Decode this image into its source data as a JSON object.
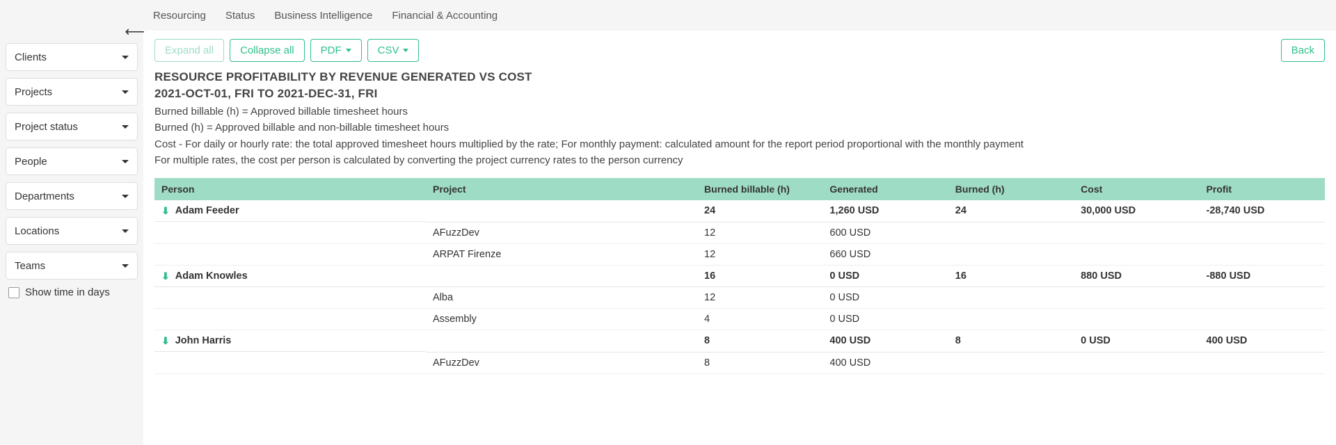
{
  "topnav": {
    "items": [
      "Resourcing",
      "Status",
      "Business Intelligence",
      "Financial & Accounting"
    ]
  },
  "sidebar": {
    "filters": [
      "Clients",
      "Projects",
      "Project status",
      "People",
      "Departments",
      "Locations",
      "Teams"
    ],
    "show_time_label": "Show time in days"
  },
  "toolbar": {
    "expand_all": "Expand all",
    "collapse_all": "Collapse all",
    "pdf": "PDF",
    "csv": "CSV",
    "back": "Back"
  },
  "report": {
    "title": "RESOURCE PROFITABILITY BY REVENUE GENERATED VS COST",
    "date_range": "2021-OCT-01, FRI TO 2021-DEC-31, FRI",
    "desc1": "Burned billable (h) = Approved billable timesheet hours",
    "desc2": "Burned (h) = Approved billable and non-billable timesheet hours",
    "desc3": "Cost - For daily or hourly rate: the total approved timesheet hours multiplied by the rate; For monthly payment: calculated amount for the report period proportional with the monthly payment",
    "desc4": "For multiple rates, the cost per person is calculated by converting the project currency rates to the person currency"
  },
  "table": {
    "headers": {
      "person": "Person",
      "project": "Project",
      "burned_billable": "Burned billable (h)",
      "generated": "Generated",
      "burned": "Burned (h)",
      "cost": "Cost",
      "profit": "Profit"
    },
    "rows": [
      {
        "type": "group",
        "person": "Adam Feeder",
        "burned_billable": "24",
        "generated": "1,260 USD",
        "burned": "24",
        "cost": "30,000 USD",
        "profit": "-28,740 USD"
      },
      {
        "type": "child",
        "project": "AFuzzDev",
        "burned_billable": "12",
        "generated": "600 USD"
      },
      {
        "type": "child",
        "project": "ARPAT Firenze",
        "burned_billable": "12",
        "generated": "660 USD"
      },
      {
        "type": "group",
        "person": "Adam Knowles",
        "burned_billable": "16",
        "generated": "0 USD",
        "burned": "16",
        "cost": "880 USD",
        "profit": "-880 USD"
      },
      {
        "type": "child",
        "project": "Alba",
        "burned_billable": "12",
        "generated": "0 USD"
      },
      {
        "type": "child",
        "project": "Assembly",
        "burned_billable": "4",
        "generated": "0 USD"
      },
      {
        "type": "group",
        "person": "John Harris",
        "burned_billable": "8",
        "generated": "400 USD",
        "burned": "8",
        "cost": "0 USD",
        "profit": "400 USD"
      },
      {
        "type": "child",
        "project": "AFuzzDev",
        "burned_billable": "8",
        "generated": "400 USD"
      }
    ]
  }
}
